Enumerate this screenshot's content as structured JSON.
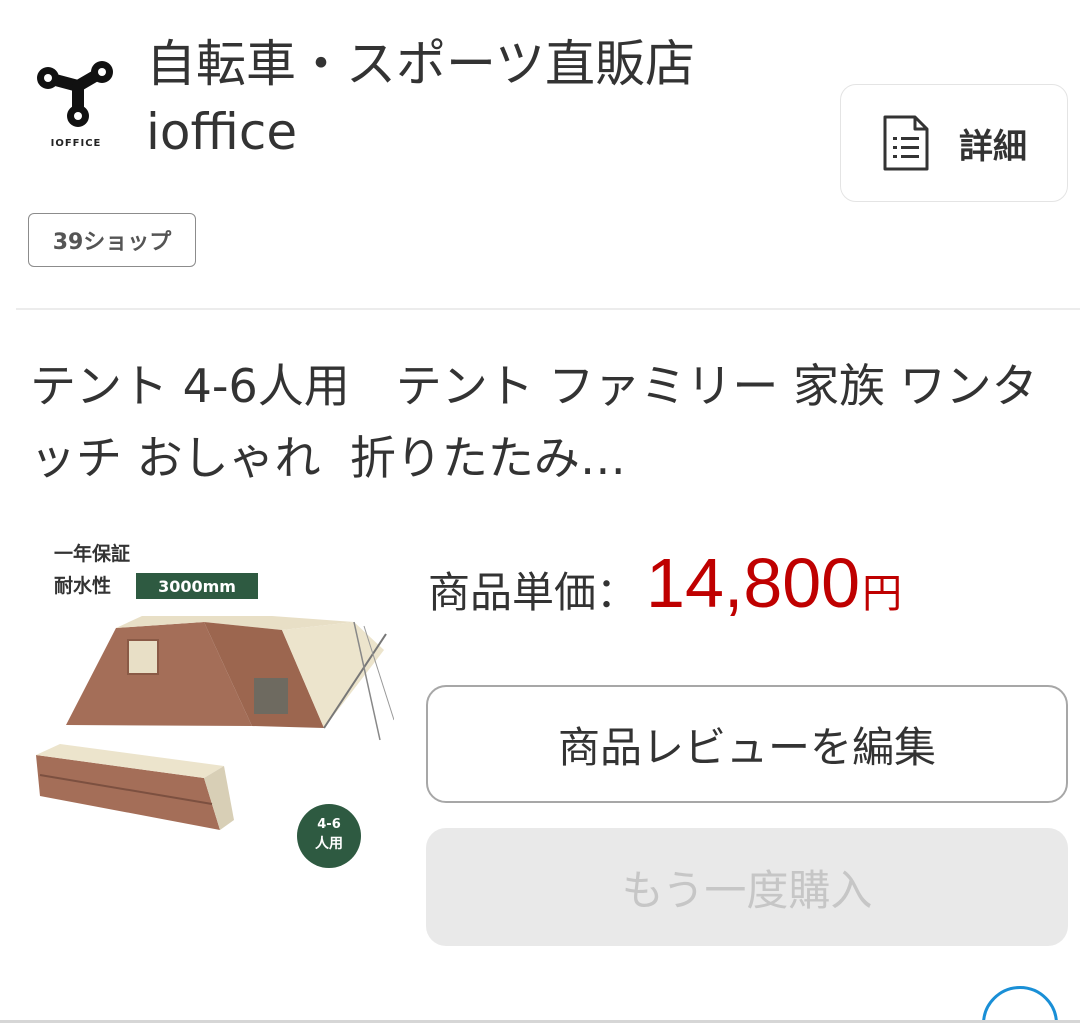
{
  "shop": {
    "name": "自転車・スポーツ直販店ioffice",
    "logo_text": "IOFFICE",
    "badge": "39ショップ",
    "detail_label": "詳細"
  },
  "product": {
    "title": "テント 4-6人用　テント ファミリー 家族 ワンタッチ おしゃれ  折りたたみ…",
    "image": {
      "warranty": "一年保証",
      "waterproof_label": "耐水性",
      "waterproof_value": "3000mm",
      "capacity_line1": "4-6",
      "capacity_line2": "人用"
    },
    "price_label": "商品単価：",
    "price_value": "14,800",
    "price_unit": "円"
  },
  "actions": {
    "review_button": "商品レビューを編集",
    "rebuy_button": "もう一度購入"
  },
  "icons": {
    "logo": "ioffice-chain-logo-icon",
    "detail": "document-list-icon",
    "more": "more-dots-icon"
  },
  "colors": {
    "price": "#bf0000",
    "badge_border": "#8c8c8c",
    "disabled_bg": "#e9e9e9",
    "fab_accent": "#1a8fd6",
    "image_green": "#2e5a41"
  }
}
